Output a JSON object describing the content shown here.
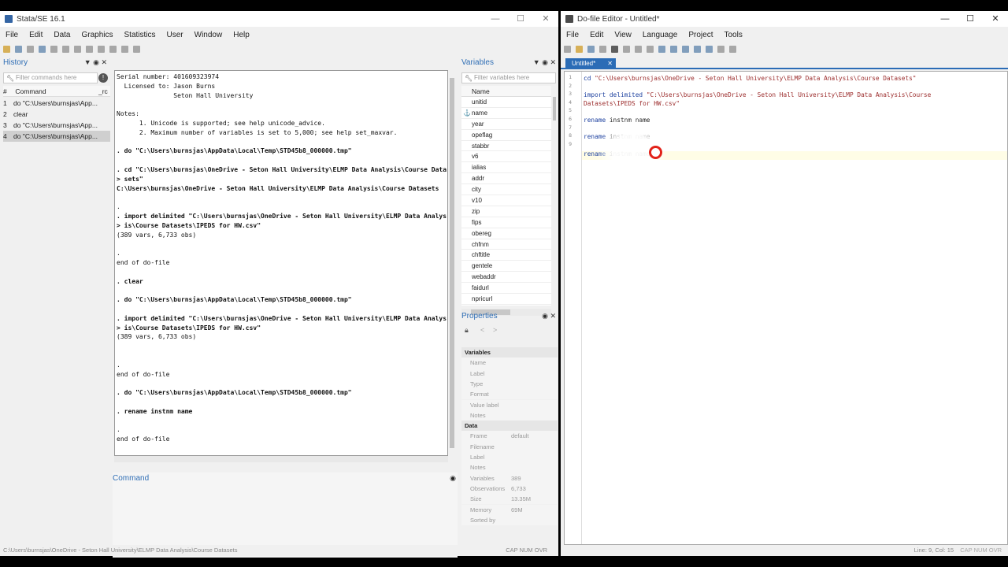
{
  "stata": {
    "title": "Stata/SE 16.1",
    "window_controls": [
      "—",
      "☐",
      "✕"
    ],
    "menu": [
      "File",
      "Edit",
      "Data",
      "Graphics",
      "Statistics",
      "User",
      "Window",
      "Help"
    ],
    "history": {
      "title": "History",
      "controls": "▼ ◉ ✕",
      "filter_placeholder": "Filter commands here",
      "col_num": "#",
      "col_command": "Command",
      "col_rc": "_rc",
      "items": [
        {
          "n": "1",
          "cmd": "do \"C:\\Users\\burnsjas\\App..."
        },
        {
          "n": "2",
          "cmd": "clear"
        },
        {
          "n": "3",
          "cmd": "do \"C:\\Users\\burnsjas\\App..."
        },
        {
          "n": "4",
          "cmd": "do \"C:\\Users\\burnsjas\\App..."
        }
      ]
    },
    "results": [
      {
        "t": "Serial number: 401609323974",
        "c": ""
      },
      {
        "t": "  Licensed to: Jason Burns",
        "c": ""
      },
      {
        "t": "               Seton Hall University",
        "c": ""
      },
      {
        "t": "",
        "c": ""
      },
      {
        "t": "Notes:",
        "c": ""
      },
      {
        "t": "      1. Unicode is supported; see help unicode_advice.",
        "c": "lk"
      },
      {
        "t": "      2. Maximum number of variables is set to 5,000; see help set_maxvar.",
        "c": "lk"
      },
      {
        "t": "",
        "c": ""
      },
      {
        "t": ". do \"C:\\Users\\burnsjas\\AppData\\Local\\Temp\\STD45b8_000000.tmp\"",
        "c": "cmd"
      },
      {
        "t": "",
        "c": ""
      },
      {
        "t": ". cd \"C:\\Users\\burnsjas\\OneDrive - Seton Hall University\\ELMP Data Analysis\\Course Data",
        "c": "cmd"
      },
      {
        "t": "> sets\"",
        "c": "cmd"
      },
      {
        "t": "C:\\Users\\burnsjas\\OneDrive - Seton Hall University\\ELMP Data Analysis\\Course Datasets",
        "c": "cmd"
      },
      {
        "t": "",
        "c": ""
      },
      {
        "t": ".",
        "c": ""
      },
      {
        "t": ". import delimited \"C:\\Users\\burnsjas\\OneDrive - Seton Hall University\\ELMP Data Analys",
        "c": "cmd"
      },
      {
        "t": "> is\\Course Datasets\\IPEDS for HW.csv\"",
        "c": "cmd"
      },
      {
        "t": "(389 vars, 6,733 obs)",
        "c": ""
      },
      {
        "t": "",
        "c": ""
      },
      {
        "t": ".",
        "c": ""
      },
      {
        "t": "end of do-file",
        "c": ""
      },
      {
        "t": "",
        "c": ""
      },
      {
        "t": ". clear",
        "c": "cmd"
      },
      {
        "t": "",
        "c": ""
      },
      {
        "t": ". do \"C:\\Users\\burnsjas\\AppData\\Local\\Temp\\STD45b8_000000.tmp\"",
        "c": "cmd"
      },
      {
        "t": "",
        "c": ""
      },
      {
        "t": ". import delimited \"C:\\Users\\burnsjas\\OneDrive - Seton Hall University\\ELMP Data Analys",
        "c": "cmd"
      },
      {
        "t": "> is\\Course Datasets\\IPEDS for HW.csv\"",
        "c": "cmd"
      },
      {
        "t": "(389 vars, 6,733 obs)",
        "c": ""
      },
      {
        "t": "",
        "c": ""
      },
      {
        "t": "",
        "c": ""
      },
      {
        "t": ".",
        "c": ""
      },
      {
        "t": "end of do-file",
        "c": ""
      },
      {
        "t": "",
        "c": ""
      },
      {
        "t": ". do \"C:\\Users\\burnsjas\\AppData\\Local\\Temp\\STD45b8_000000.tmp\"",
        "c": "cmd"
      },
      {
        "t": "",
        "c": ""
      },
      {
        "t": ". rename instnm name",
        "c": "cmd"
      },
      {
        "t": "",
        "c": ""
      },
      {
        "t": ".",
        "c": ""
      },
      {
        "t": "end of do-file",
        "c": ""
      },
      {
        "t": "",
        "c": ""
      },
      {
        "t": ".",
        "c": ""
      }
    ],
    "command_label": "Command",
    "command_pin": "◉",
    "variables": {
      "title": "Variables",
      "controls": "▼ ◉ ✕",
      "filter_placeholder": "Filter variables here",
      "col_name": "Name",
      "items": [
        "unitid",
        "name",
        "year",
        "opeflag",
        "stabbr",
        "v6",
        "ialias",
        "addr",
        "city",
        "v10",
        "zip",
        "fips",
        "obereg",
        "chfnm",
        "chftitle",
        "gentele",
        "webaddr",
        "faidurl",
        "npricurl"
      ]
    },
    "properties": {
      "title": "Properties",
      "controls": "◉ ✕",
      "variables_section": "Variables",
      "var_fields": [
        "Name",
        "Label",
        "Type",
        "Format",
        "Value label",
        "Notes"
      ],
      "data_section": "Data",
      "data_fields": [
        {
          "k": "Frame",
          "v": "default"
        },
        {
          "k": "Filename",
          "v": ""
        },
        {
          "k": "Label",
          "v": ""
        },
        {
          "k": "Notes",
          "v": ""
        },
        {
          "k": "Variables",
          "v": "389"
        },
        {
          "k": "Observations",
          "v": "6,733"
        },
        {
          "k": "Size",
          "v": "13.35M"
        },
        {
          "k": "Memory",
          "v": "69M"
        },
        {
          "k": "Sorted by",
          "v": ""
        }
      ]
    },
    "status_path": "C:\\Users\\burnsjas\\OneDrive - Seton Hall University\\ELMP Data Analysis\\Course Datasets",
    "status_flags": "CAP  NUM  OVR"
  },
  "editor": {
    "title": "Do-file Editor - Untitled*",
    "window_controls": [
      "—",
      "☐",
      "✕"
    ],
    "menu": [
      "File",
      "Edit",
      "View",
      "Language",
      "Project",
      "Tools"
    ],
    "tab_label": "Untitled*",
    "tab_close": "✕",
    "line_numbers": [
      "1",
      "2",
      "3",
      "4",
      "5",
      "6",
      "7",
      "8",
      "9"
    ],
    "code": [
      {
        "kw": "cd ",
        "str": "\"C:\\Users\\burnsjas\\OneDrive - Seton Hall University\\ELMP Data Analysis\\Course Datasets\"",
        "rest": ""
      },
      {
        "kw": "",
        "str": "",
        "rest": ""
      },
      {
        "kw": "import delimited ",
        "str": "\"C:\\Users\\burnsjas\\OneDrive - Seton Hall University\\ELMP Data Analysis\\Course",
        "rest": ""
      },
      {
        "kw": "",
        "str": "Datasets\\IPEDS for HW.csv\"",
        "rest": ""
      },
      {
        "kw": "",
        "str": "",
        "rest": ""
      },
      {
        "kw": "rename ",
        "str": "",
        "rest": "instnm name"
      },
      {
        "kw": "",
        "str": "",
        "rest": ""
      },
      {
        "kw": "rename ",
        "str": "",
        "rest": "instnm name"
      },
      {
        "kw": "",
        "str": "",
        "rest": ""
      },
      {
        "kw": "rename ",
        "str": "",
        "rest": "instnm name"
      }
    ],
    "status_pos": "Line: 9, Col: 15",
    "status_flags": "CAP  NUM  OVR"
  }
}
